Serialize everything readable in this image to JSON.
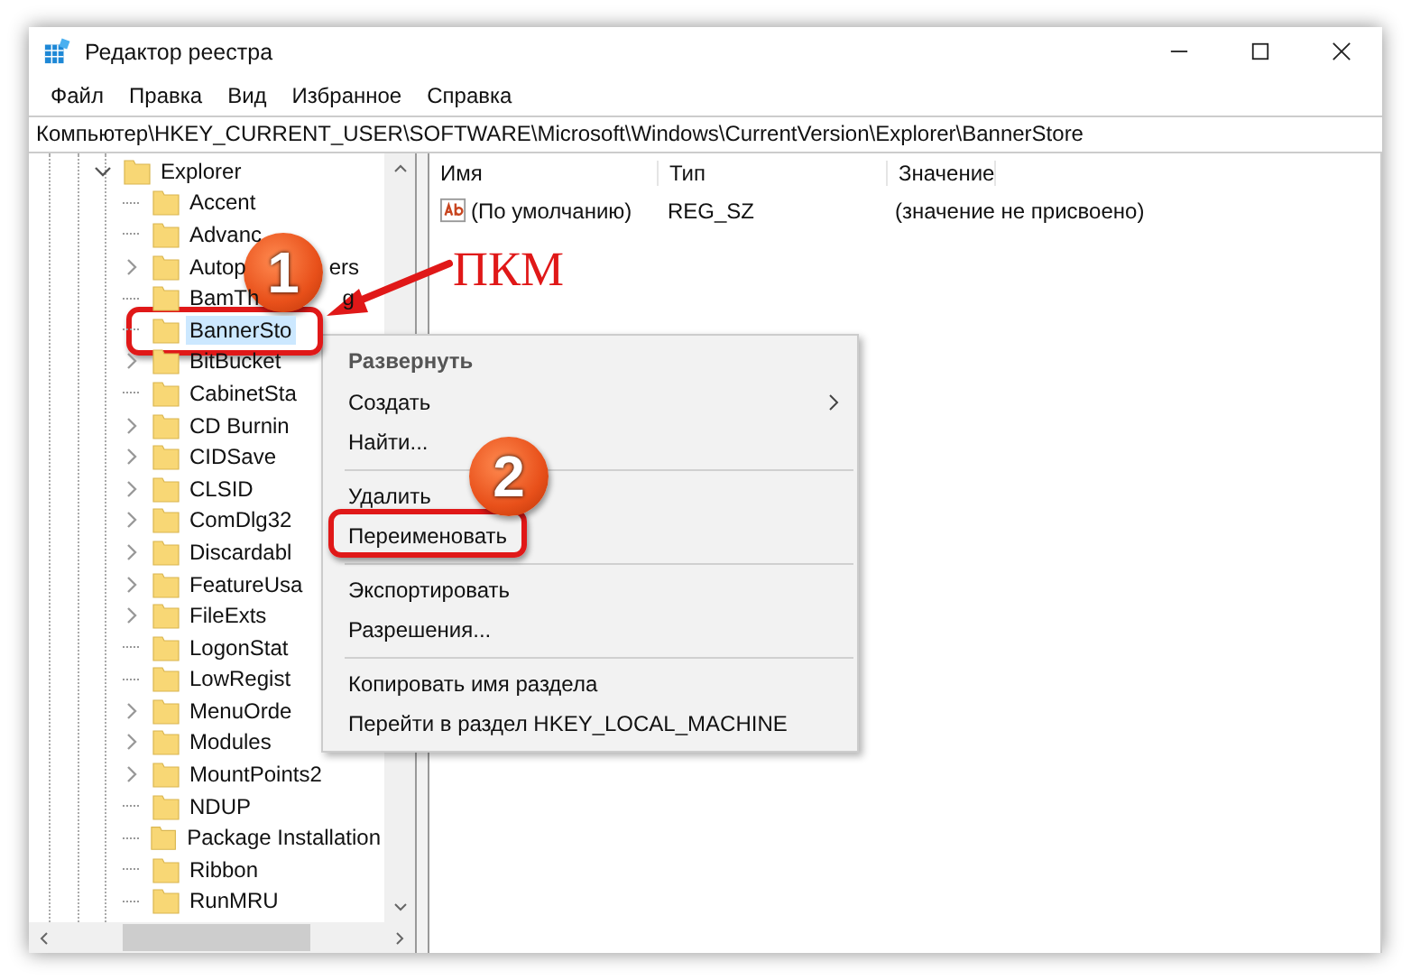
{
  "window": {
    "title": "Редактор реестра"
  },
  "menu_bar": [
    "Файл",
    "Правка",
    "Вид",
    "Избранное",
    "Справка"
  ],
  "address_bar": "Компьютер\\HKEY_CURRENT_USER\\SOFTWARE\\Microsoft\\Windows\\CurrentVersion\\Explorer\\BannerStore",
  "tree": {
    "label": "Explorer",
    "expanded": true,
    "children": [
      {
        "label": "Accent",
        "expandable": false,
        "selected": false
      },
      {
        "label": "Advanc",
        "expandable": false,
        "selected": false
      },
      {
        "label": "Autop",
        "tail": "ers",
        "expandable": true,
        "selected": false
      },
      {
        "label": "BamTh",
        "tail": "g",
        "expandable": false,
        "selected": false
      },
      {
        "label": "BannerSto",
        "expandable": false,
        "selected": true
      },
      {
        "label": "BitBucket",
        "expandable": true,
        "selected": false
      },
      {
        "label": "CabinetSta",
        "expandable": false,
        "selected": false
      },
      {
        "label": "CD Burnin",
        "expandable": true,
        "selected": false
      },
      {
        "label": "CIDSave",
        "expandable": true,
        "selected": false
      },
      {
        "label": "CLSID",
        "expandable": true,
        "selected": false
      },
      {
        "label": "ComDlg32",
        "expandable": true,
        "selected": false
      },
      {
        "label": "Discardabl",
        "expandable": true,
        "selected": false
      },
      {
        "label": "FeatureUsa",
        "expandable": true,
        "selected": false
      },
      {
        "label": "FileExts",
        "expandable": true,
        "selected": false
      },
      {
        "label": "LogonStat",
        "expandable": false,
        "selected": false
      },
      {
        "label": "LowRegist",
        "expandable": false,
        "selected": false
      },
      {
        "label": "MenuOrde",
        "expandable": true,
        "selected": false
      },
      {
        "label": "Modules",
        "expandable": true,
        "selected": false
      },
      {
        "label": "MountPoints2",
        "expandable": true,
        "selected": false
      },
      {
        "label": "NDUP",
        "expandable": false,
        "selected": false
      },
      {
        "label": "Package Installation",
        "expandable": false,
        "selected": false
      },
      {
        "label": "Ribbon",
        "expandable": false,
        "selected": false
      },
      {
        "label": "RunMRU",
        "expandable": false,
        "selected": false
      }
    ]
  },
  "values_table": {
    "columns": [
      "Имя",
      "Тип",
      "Значение"
    ],
    "rows": [
      {
        "name": "(По умолчанию)",
        "type": "REG_SZ",
        "data": "(значение не присвоено)"
      }
    ]
  },
  "context_menu": [
    {
      "kind": "bold",
      "label": "Развернуть"
    },
    {
      "kind": "submenu",
      "label": "Создать"
    },
    {
      "kind": "item",
      "label": "Найти..."
    },
    {
      "kind": "separator"
    },
    {
      "kind": "item",
      "label": "Удалить"
    },
    {
      "kind": "item",
      "label": "Переименовать"
    },
    {
      "kind": "separator"
    },
    {
      "kind": "item",
      "label": "Экспортировать"
    },
    {
      "kind": "item",
      "label": "Разрешения..."
    },
    {
      "kind": "separator"
    },
    {
      "kind": "item",
      "label": "Копировать имя раздела"
    },
    {
      "kind": "item",
      "label": "Перейти в раздел HKEY_LOCAL_MACHINE"
    }
  ],
  "annotations": {
    "step_1": "1",
    "step_2": "2",
    "label": "ПКМ"
  }
}
